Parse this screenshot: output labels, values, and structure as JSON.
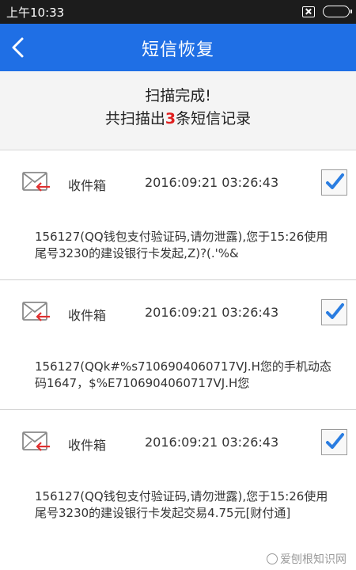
{
  "status_bar": {
    "time": "上午10:33",
    "icons": [
      "sim-card-icon",
      "battery-icon"
    ]
  },
  "header": {
    "title": "短信恢复",
    "back_icon": "chevron-left-icon"
  },
  "scan": {
    "title": "扫描完成!",
    "count_prefix": "共扫描出",
    "count": "3",
    "count_suffix": "条短信记录"
  },
  "messages": [
    {
      "folder": "收件箱",
      "datetime": "2016:09:21   03:26:43",
      "checked": true,
      "body": "156127(QQ钱包支付验证码,请勿泄露),您于15:26使用尾号3230的建设银行卡发起,Z)?(.'%&"
    },
    {
      "folder": "收件箱",
      "datetime": "2016:09:21   03:26:43",
      "checked": true,
      "body": "156127(QQk#%s7106904060717VJ.H您的手机动态码1647，$%E7106904060717VJ.H您"
    },
    {
      "folder": "收件箱",
      "datetime": "2016:09:21   03:26:43",
      "checked": true,
      "body": "156127(QQ钱包支付验证码,请勿泄露),您于15:26使用尾号3230的建设银行卡发起交易4.75元[财付通]"
    }
  ],
  "watermark": {
    "text": "爱刨根知识网"
  },
  "colors": {
    "header": "#1f6fe5",
    "status_bar": "#1c1c1c",
    "check": "#2a7de1",
    "count_highlight": "#e02020",
    "envelope_arrow": "#e03030"
  }
}
